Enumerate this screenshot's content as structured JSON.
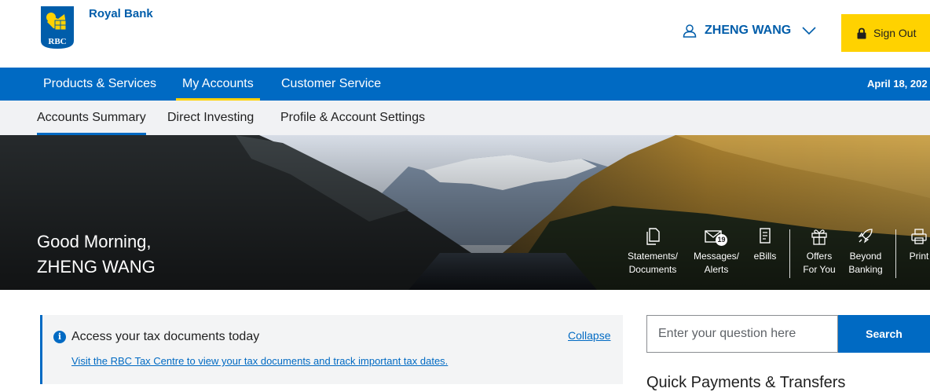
{
  "brand": {
    "logo_text": "RBC",
    "name": "Royal Bank",
    "color": "#005daa",
    "accent": "#ffd200"
  },
  "header": {
    "user_name": "ZHENG WANG",
    "sign_out_label": "Sign Out"
  },
  "primary_nav": {
    "items": [
      {
        "label": "Products & Services"
      },
      {
        "label": "My Accounts",
        "active": true
      },
      {
        "label": "Customer Service"
      }
    ],
    "date": "April 18, 202"
  },
  "secondary_nav": {
    "items": [
      {
        "label": "Accounts Summary",
        "active": true
      },
      {
        "label": "Direct Investing"
      },
      {
        "label": "Profile & Account Settings"
      }
    ]
  },
  "hero": {
    "greeting_line1": "Good Morning,",
    "greeting_line2": "ZHENG WANG",
    "quick_actions": [
      {
        "icon": "document-icon",
        "line1": "Statements/",
        "line2": "Documents"
      },
      {
        "icon": "envelope-icon",
        "line1": "Messages/",
        "line2": "Alerts",
        "badge": "19"
      },
      {
        "icon": "bill-icon",
        "line1": "eBills",
        "line2": ""
      },
      {
        "icon": "gift-icon",
        "line1": "Offers",
        "line2": "For You"
      },
      {
        "icon": "rocket-icon",
        "line1": "Beyond",
        "line2": "Banking"
      },
      {
        "icon": "printer-icon",
        "line1": "Print",
        "line2": ""
      }
    ]
  },
  "notice": {
    "title": "Access your tax documents today",
    "link": "Visit the RBC Tax Centre to view your tax documents and track important tax dates.",
    "collapse_label": "Collapse"
  },
  "search": {
    "placeholder": "Enter your question here",
    "button_label": "Search"
  },
  "quick_payments": {
    "title": "Quick Payments & Transfers"
  }
}
